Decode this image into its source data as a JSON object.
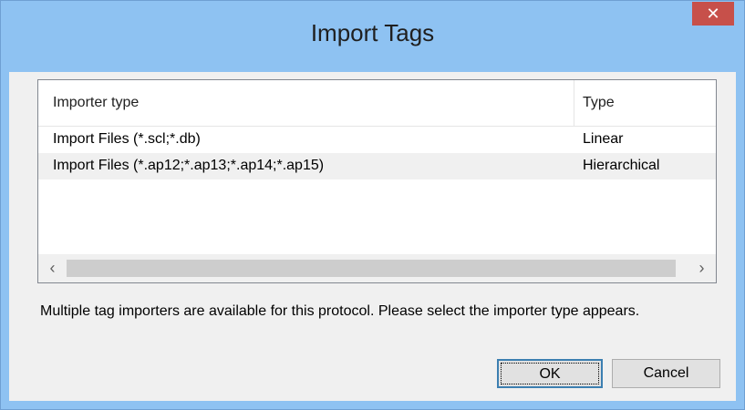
{
  "window": {
    "title": "Import Tags",
    "close_glyph": "✕"
  },
  "list": {
    "columns": [
      "Importer type",
      "Type"
    ],
    "rows": [
      {
        "importer": "Import Files (*.scl;*.db)",
        "type": "Linear"
      },
      {
        "importer": "Import Files (*.ap12;*.ap13;*.ap14;*.ap15)",
        "type": "Hierarchical"
      }
    ],
    "scroll_left_glyph": "‹",
    "scroll_right_glyph": "›"
  },
  "message": "Multiple tag importers are available for this protocol. Please select the importer type appears.",
  "buttons": {
    "ok": "OK",
    "cancel": "Cancel"
  },
  "colors": {
    "titlebar": "#8ec2f2",
    "close_button": "#c7504a",
    "client_bg": "#f0f0f0"
  },
  "icons": {
    "close": "close-icon",
    "scroll_left": "chevron-left-icon",
    "scroll_right": "chevron-right-icon"
  }
}
